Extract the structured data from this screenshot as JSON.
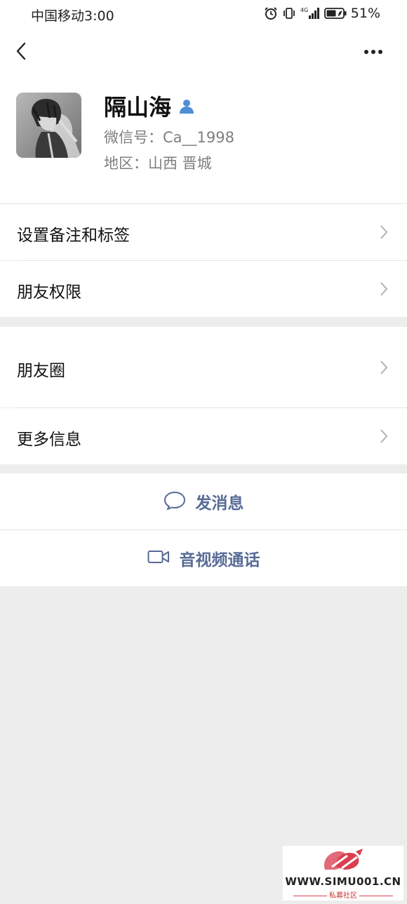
{
  "status_bar": {
    "carrier": "中国移动",
    "time": "3:00",
    "network": "4G",
    "battery": "51%"
  },
  "profile": {
    "name": "隔山海",
    "wechat_id": "微信号：Ca__1998",
    "region": "地区：山西  晋城"
  },
  "menu": {
    "remark_tags": "设置备注和标签",
    "friend_permissions": "朋友权限",
    "moments": "朋友圈",
    "more_info": "更多信息"
  },
  "actions": {
    "send_message": "发消息",
    "video_call": "音视频通话"
  },
  "watermark": {
    "url": "WWW.SIMU001.CN",
    "subtitle": "私募社区"
  },
  "colors": {
    "link_blue": "#576b95",
    "background_gray": "#ededed",
    "watermark_red": "#d94050"
  }
}
